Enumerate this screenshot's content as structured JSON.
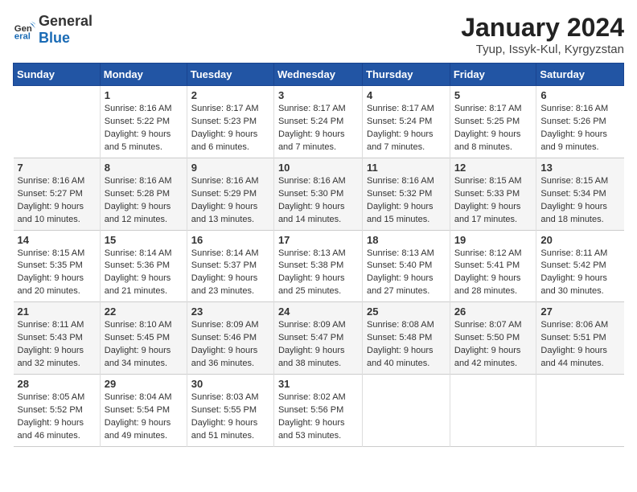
{
  "header": {
    "logo_general": "General",
    "logo_blue": "Blue",
    "main_title": "January 2024",
    "subtitle": "Tyup, Issyk-Kul, Kyrgyzstan"
  },
  "days_of_week": [
    "Sunday",
    "Monday",
    "Tuesday",
    "Wednesday",
    "Thursday",
    "Friday",
    "Saturday"
  ],
  "weeks": [
    [
      {
        "day": "",
        "sunrise": "",
        "sunset": "",
        "daylight": ""
      },
      {
        "day": "1",
        "sunrise": "Sunrise: 8:16 AM",
        "sunset": "Sunset: 5:22 PM",
        "daylight": "Daylight: 9 hours and 5 minutes."
      },
      {
        "day": "2",
        "sunrise": "Sunrise: 8:17 AM",
        "sunset": "Sunset: 5:23 PM",
        "daylight": "Daylight: 9 hours and 6 minutes."
      },
      {
        "day": "3",
        "sunrise": "Sunrise: 8:17 AM",
        "sunset": "Sunset: 5:24 PM",
        "daylight": "Daylight: 9 hours and 7 minutes."
      },
      {
        "day": "4",
        "sunrise": "Sunrise: 8:17 AM",
        "sunset": "Sunset: 5:24 PM",
        "daylight": "Daylight: 9 hours and 7 minutes."
      },
      {
        "day": "5",
        "sunrise": "Sunrise: 8:17 AM",
        "sunset": "Sunset: 5:25 PM",
        "daylight": "Daylight: 9 hours and 8 minutes."
      },
      {
        "day": "6",
        "sunrise": "Sunrise: 8:16 AM",
        "sunset": "Sunset: 5:26 PM",
        "daylight": "Daylight: 9 hours and 9 minutes."
      }
    ],
    [
      {
        "day": "7",
        "sunrise": "Sunrise: 8:16 AM",
        "sunset": "Sunset: 5:27 PM",
        "daylight": "Daylight: 9 hours and 10 minutes."
      },
      {
        "day": "8",
        "sunrise": "Sunrise: 8:16 AM",
        "sunset": "Sunset: 5:28 PM",
        "daylight": "Daylight: 9 hours and 12 minutes."
      },
      {
        "day": "9",
        "sunrise": "Sunrise: 8:16 AM",
        "sunset": "Sunset: 5:29 PM",
        "daylight": "Daylight: 9 hours and 13 minutes."
      },
      {
        "day": "10",
        "sunrise": "Sunrise: 8:16 AM",
        "sunset": "Sunset: 5:30 PM",
        "daylight": "Daylight: 9 hours and 14 minutes."
      },
      {
        "day": "11",
        "sunrise": "Sunrise: 8:16 AM",
        "sunset": "Sunset: 5:32 PM",
        "daylight": "Daylight: 9 hours and 15 minutes."
      },
      {
        "day": "12",
        "sunrise": "Sunrise: 8:15 AM",
        "sunset": "Sunset: 5:33 PM",
        "daylight": "Daylight: 9 hours and 17 minutes."
      },
      {
        "day": "13",
        "sunrise": "Sunrise: 8:15 AM",
        "sunset": "Sunset: 5:34 PM",
        "daylight": "Daylight: 9 hours and 18 minutes."
      }
    ],
    [
      {
        "day": "14",
        "sunrise": "Sunrise: 8:15 AM",
        "sunset": "Sunset: 5:35 PM",
        "daylight": "Daylight: 9 hours and 20 minutes."
      },
      {
        "day": "15",
        "sunrise": "Sunrise: 8:14 AM",
        "sunset": "Sunset: 5:36 PM",
        "daylight": "Daylight: 9 hours and 21 minutes."
      },
      {
        "day": "16",
        "sunrise": "Sunrise: 8:14 AM",
        "sunset": "Sunset: 5:37 PM",
        "daylight": "Daylight: 9 hours and 23 minutes."
      },
      {
        "day": "17",
        "sunrise": "Sunrise: 8:13 AM",
        "sunset": "Sunset: 5:38 PM",
        "daylight": "Daylight: 9 hours and 25 minutes."
      },
      {
        "day": "18",
        "sunrise": "Sunrise: 8:13 AM",
        "sunset": "Sunset: 5:40 PM",
        "daylight": "Daylight: 9 hours and 27 minutes."
      },
      {
        "day": "19",
        "sunrise": "Sunrise: 8:12 AM",
        "sunset": "Sunset: 5:41 PM",
        "daylight": "Daylight: 9 hours and 28 minutes."
      },
      {
        "day": "20",
        "sunrise": "Sunrise: 8:11 AM",
        "sunset": "Sunset: 5:42 PM",
        "daylight": "Daylight: 9 hours and 30 minutes."
      }
    ],
    [
      {
        "day": "21",
        "sunrise": "Sunrise: 8:11 AM",
        "sunset": "Sunset: 5:43 PM",
        "daylight": "Daylight: 9 hours and 32 minutes."
      },
      {
        "day": "22",
        "sunrise": "Sunrise: 8:10 AM",
        "sunset": "Sunset: 5:45 PM",
        "daylight": "Daylight: 9 hours and 34 minutes."
      },
      {
        "day": "23",
        "sunrise": "Sunrise: 8:09 AM",
        "sunset": "Sunset: 5:46 PM",
        "daylight": "Daylight: 9 hours and 36 minutes."
      },
      {
        "day": "24",
        "sunrise": "Sunrise: 8:09 AM",
        "sunset": "Sunset: 5:47 PM",
        "daylight": "Daylight: 9 hours and 38 minutes."
      },
      {
        "day": "25",
        "sunrise": "Sunrise: 8:08 AM",
        "sunset": "Sunset: 5:48 PM",
        "daylight": "Daylight: 9 hours and 40 minutes."
      },
      {
        "day": "26",
        "sunrise": "Sunrise: 8:07 AM",
        "sunset": "Sunset: 5:50 PM",
        "daylight": "Daylight: 9 hours and 42 minutes."
      },
      {
        "day": "27",
        "sunrise": "Sunrise: 8:06 AM",
        "sunset": "Sunset: 5:51 PM",
        "daylight": "Daylight: 9 hours and 44 minutes."
      }
    ],
    [
      {
        "day": "28",
        "sunrise": "Sunrise: 8:05 AM",
        "sunset": "Sunset: 5:52 PM",
        "daylight": "Daylight: 9 hours and 46 minutes."
      },
      {
        "day": "29",
        "sunrise": "Sunrise: 8:04 AM",
        "sunset": "Sunset: 5:54 PM",
        "daylight": "Daylight: 9 hours and 49 minutes."
      },
      {
        "day": "30",
        "sunrise": "Sunrise: 8:03 AM",
        "sunset": "Sunset: 5:55 PM",
        "daylight": "Daylight: 9 hours and 51 minutes."
      },
      {
        "day": "31",
        "sunrise": "Sunrise: 8:02 AM",
        "sunset": "Sunset: 5:56 PM",
        "daylight": "Daylight: 9 hours and 53 minutes."
      },
      {
        "day": "",
        "sunrise": "",
        "sunset": "",
        "daylight": ""
      },
      {
        "day": "",
        "sunrise": "",
        "sunset": "",
        "daylight": ""
      },
      {
        "day": "",
        "sunrise": "",
        "sunset": "",
        "daylight": ""
      }
    ]
  ]
}
